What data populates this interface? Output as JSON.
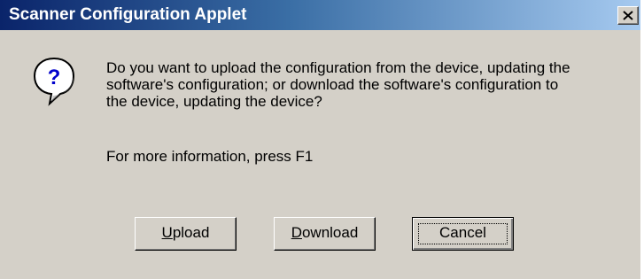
{
  "window": {
    "title": "Scanner Configuration Applet",
    "close_glyph": "×",
    "background": "#d4d0c8",
    "title_color": "#0a246a"
  },
  "icon": {
    "name": "question-icon",
    "glyph": "?"
  },
  "message": {
    "lines": [
      "Do you want to upload the configuration from the device, updating the",
      "software's configuration; or download the software's configuration to",
      "the device, updating the device?"
    ],
    "info": "For more information, press F1"
  },
  "buttons": {
    "upload": {
      "mnemonic": "U",
      "rest": "pload"
    },
    "download": {
      "mnemonic": "D",
      "rest": "ownload"
    },
    "cancel": {
      "label": "Cancel"
    }
  }
}
